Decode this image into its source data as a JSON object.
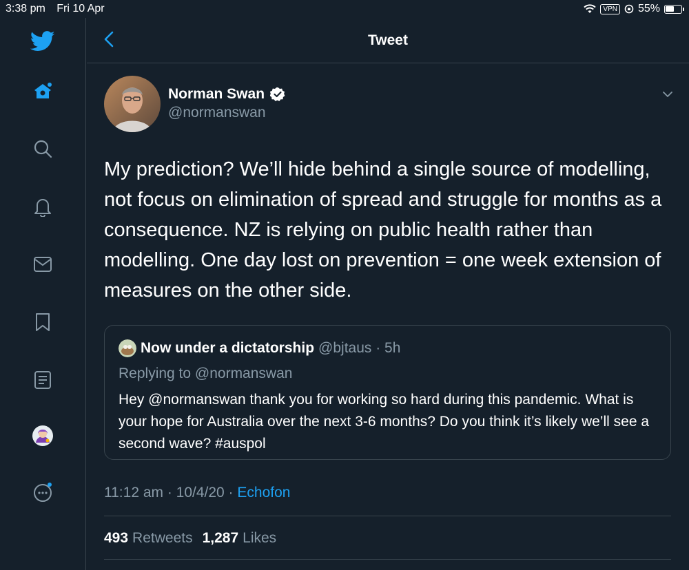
{
  "status_bar": {
    "time": "3:38 pm",
    "date": "Fri 10 Apr",
    "vpn": "VPN",
    "battery": "55%"
  },
  "sidebar": {
    "items": [
      {
        "icon": "twitter-logo-icon"
      },
      {
        "icon": "home-icon"
      },
      {
        "icon": "search-icon"
      },
      {
        "icon": "bell-icon"
      },
      {
        "icon": "mail-icon"
      },
      {
        "icon": "bookmark-icon"
      },
      {
        "icon": "lists-icon"
      },
      {
        "icon": "profile-avatar"
      },
      {
        "icon": "more-icon"
      }
    ]
  },
  "header": {
    "title": "Tweet"
  },
  "tweet": {
    "author_name": "Norman Swan",
    "author_handle": "@normanswan",
    "text": "My prediction? We’ll hide behind a single source of modelling, not focus on elimination of spread and struggle for months as a consequence. NZ is relying on public health rather than modelling. One day lost on prevention = one week extension of measures on the other side.",
    "timestamp": "11:12 am · 10/4/20 · ",
    "source": "Echofon",
    "retweets_count": "493",
    "retweets_label": "Retweets",
    "likes_count": "1,287",
    "likes_label": "Likes"
  },
  "quoted_tweet": {
    "author_name": "Now under a dictatorship",
    "meta": "@bjtaus · 5h",
    "replying_to": "Replying to @normanswan",
    "text": "Hey @normanswan thank you for working so hard during this pandemic. What is your hope for Australia over the next 3-6 months? Do you think it’s likely we’ll see a second wave? #auspol"
  },
  "colors": {
    "background": "#15202b",
    "accent": "#1da1f2",
    "secondary_text": "#8899a6",
    "border": "#38444d"
  }
}
